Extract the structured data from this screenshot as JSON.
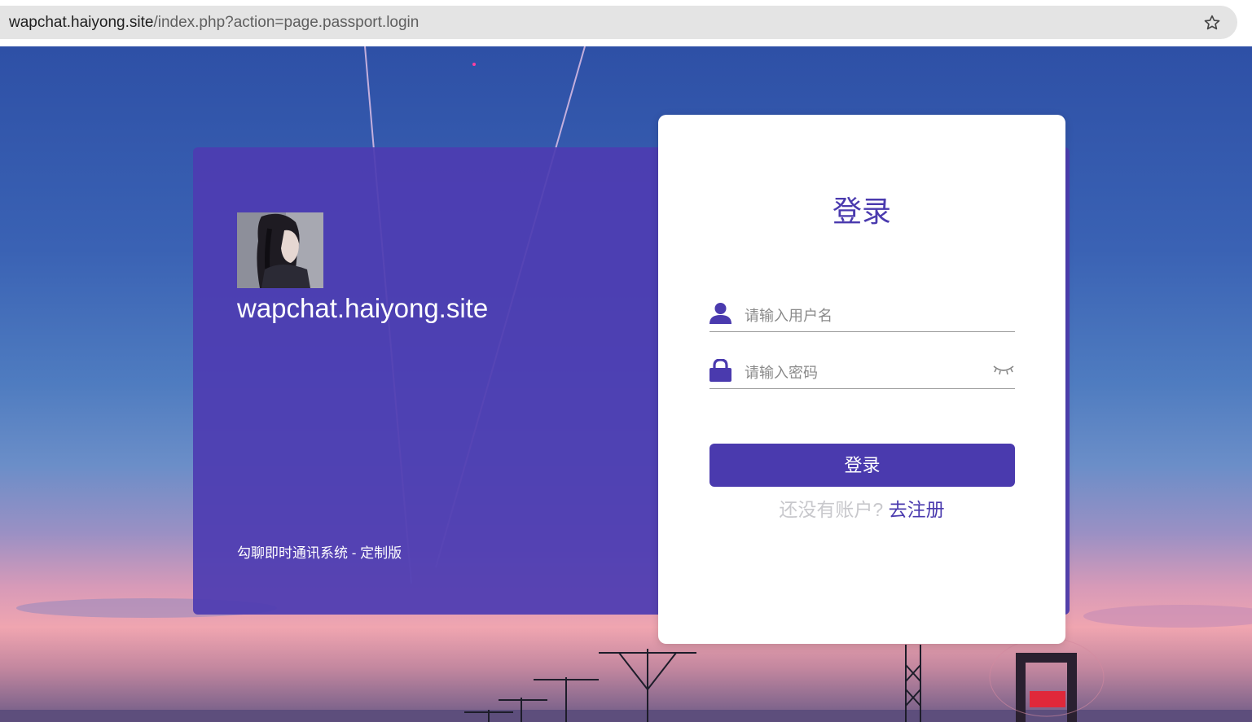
{
  "browser": {
    "url_host": "wapchat.haiyong.site",
    "url_path": "/index.php?action=page.passport.login",
    "bookmark_icon": "star-outline-icon"
  },
  "brand_panel": {
    "site_name": "wapchat.haiyong.site",
    "system_name": "勾聊即时通讯系统 - 定制版"
  },
  "login": {
    "title": "登录",
    "username_placeholder": "请输入用户名",
    "password_placeholder": "请输入密码",
    "username_icon": "user-icon",
    "password_icon": "lock-icon",
    "toggle_icon": "eye-closed-icon",
    "submit_label": "登录",
    "register_prompt": "还没有账户?",
    "register_link": "去注册"
  },
  "colors": {
    "accent": "#4a3aae",
    "panel": "#4e3cb2",
    "card": "#ffffff"
  }
}
